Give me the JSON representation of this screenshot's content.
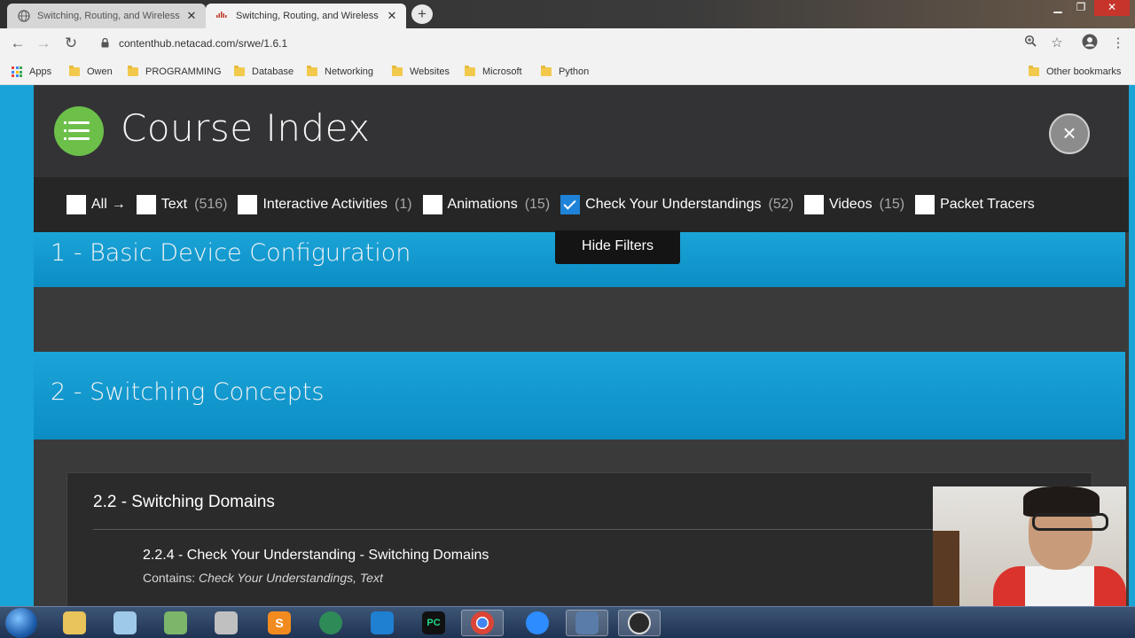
{
  "browser": {
    "tabs": [
      {
        "title": "Switching, Routing, and Wireless",
        "active": false
      },
      {
        "title": "Switching, Routing, and Wireless",
        "active": true
      }
    ],
    "new_tab": "+",
    "url": "contenthub.netacad.com/srwe/1.6.1",
    "bookmarks": [
      "Apps",
      "Owen",
      "PROGRAMMING",
      "Database",
      "Networking",
      "Websites",
      "Microsoft",
      "Python"
    ],
    "other_bookmarks": "Other bookmarks"
  },
  "page": {
    "title": "Course Index",
    "close_icon": "×",
    "filters": [
      {
        "label": "All",
        "count": "",
        "checked": false,
        "arrow": "→"
      },
      {
        "label": "Text",
        "count": "(516)",
        "checked": false
      },
      {
        "label": "Interactive Activities",
        "count": "(1)",
        "checked": false
      },
      {
        "label": "Animations",
        "count": "(15)",
        "checked": false
      },
      {
        "label": "Check Your Understandings",
        "count": "(52)",
        "checked": true
      },
      {
        "label": "Videos",
        "count": "(15)",
        "checked": false
      },
      {
        "label": "Packet Tracers",
        "count": "",
        "checked": false
      }
    ],
    "hide_filters": "Hide Filters",
    "modules": [
      {
        "title": "1 - Basic Device Configuration"
      },
      {
        "title": "2 - Switching Concepts"
      }
    ],
    "section": {
      "title": "2.2 - Switching Domains",
      "topic_title": "2.2.4 - Check Your Understanding - Switching Domains",
      "contains_label": "Contains:",
      "contains_value": "Check Your Understandings, Text"
    }
  },
  "colors": {
    "accent_blue": "#1ba4d8",
    "menu_green": "#6cc04a",
    "check_blue": "#1e83d8"
  }
}
